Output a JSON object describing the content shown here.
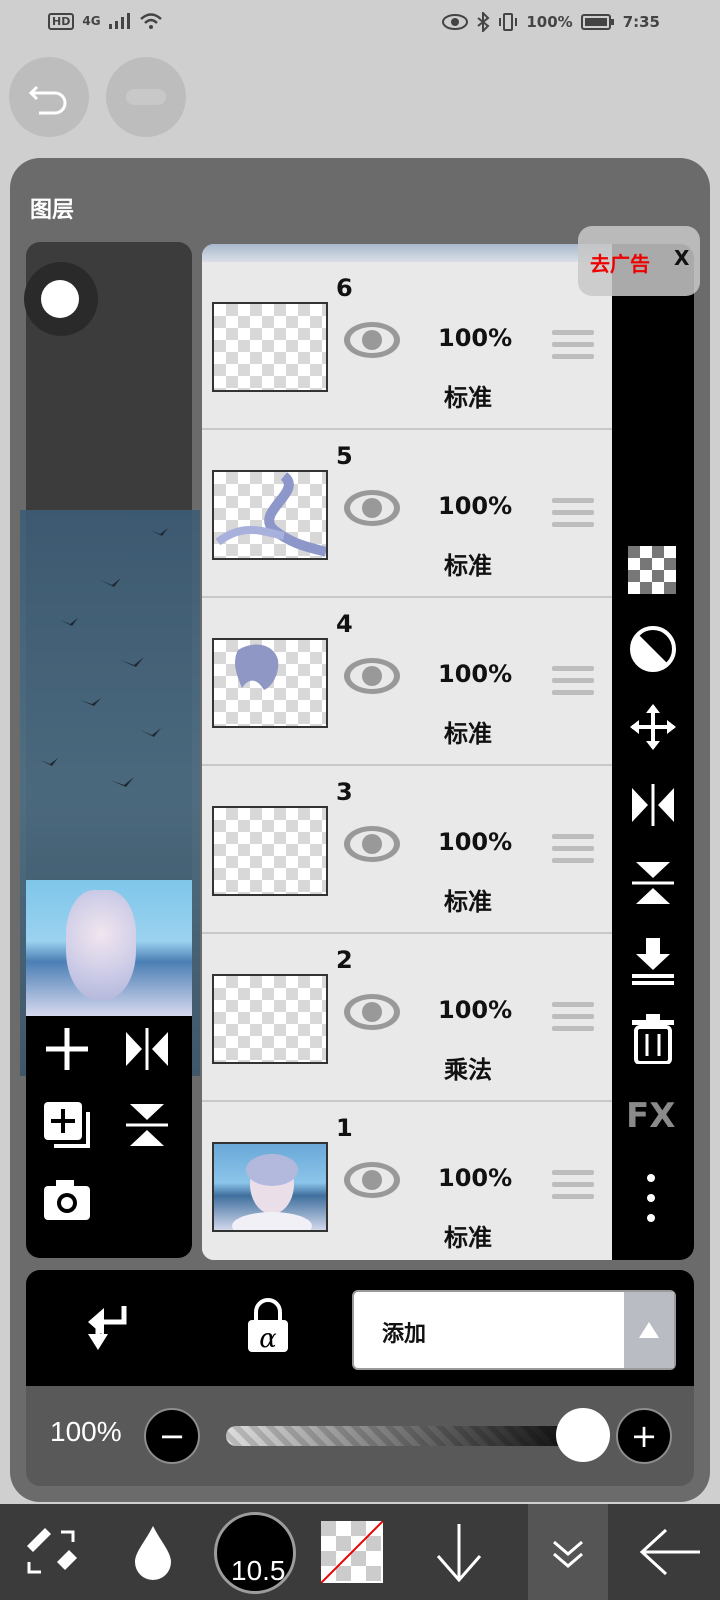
{
  "status_bar": {
    "network": "HD",
    "signal": "4G",
    "battery": "100%",
    "time": "7:35"
  },
  "panel": {
    "title": "图层"
  },
  "layers": [
    {
      "number": "6",
      "opacity": "100%",
      "blend": "标准"
    },
    {
      "number": "5",
      "opacity": "100%",
      "blend": "标准"
    },
    {
      "number": "4",
      "opacity": "100%",
      "blend": "标准"
    },
    {
      "number": "3",
      "opacity": "100%",
      "blend": "标准"
    },
    {
      "number": "2",
      "opacity": "100%",
      "blend": "乘法"
    },
    {
      "number": "1",
      "opacity": "100%",
      "blend": "标准"
    }
  ],
  "ad": {
    "text": "去广告",
    "close": "X"
  },
  "right_tools": {
    "fx": "FX"
  },
  "blend_select": {
    "value": "添加"
  },
  "opacity_control": {
    "value": "100%",
    "minus": "−",
    "plus": "+",
    "level": 1.0
  },
  "toolbar": {
    "brush_size": "10.5"
  }
}
